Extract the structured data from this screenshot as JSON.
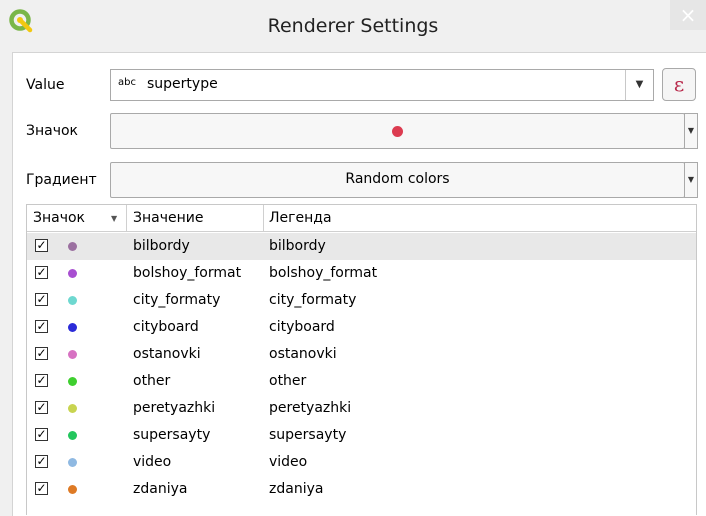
{
  "window": {
    "title": "Renderer Settings",
    "close_glyph": "×"
  },
  "form": {
    "value_label": "Value",
    "value_type_badge": "abc",
    "value_field": "supertype",
    "combo_arrow": "▼",
    "expression_glyph": "ε",
    "symbol_label": "Значок",
    "symbol_color": "#dc3b50",
    "ramp_label": "Градиент",
    "ramp_value": "Random colors"
  },
  "table": {
    "columns": [
      "Значок",
      "Значение",
      "Легенда"
    ],
    "sort_glyph": "▼",
    "check_glyph": "✓",
    "rows": [
      {
        "value": "bilbordy",
        "legend": "bilbordy",
        "color": "#9b70a0",
        "checked": true,
        "selected": true
      },
      {
        "value": "bolshoy_format",
        "legend": "bolshoy_format",
        "color": "#a84fd1",
        "checked": true
      },
      {
        "value": "city_formaty",
        "legend": "city_formaty",
        "color": "#6ed8d0",
        "checked": true
      },
      {
        "value": "cityboard",
        "legend": "cityboard",
        "color": "#2b2bd8",
        "checked": true
      },
      {
        "value": "ostanovki",
        "legend": "ostanovki",
        "color": "#d772c2",
        "checked": true
      },
      {
        "value": "other",
        "legend": "other",
        "color": "#3fcf2f",
        "checked": true
      },
      {
        "value": "peretyazhki",
        "legend": "peretyazhki",
        "color": "#c8d450",
        "checked": true
      },
      {
        "value": "supersayty",
        "legend": "supersayty",
        "color": "#23c65d",
        "checked": true
      },
      {
        "value": "video",
        "legend": "video",
        "color": "#8fb9e2",
        "checked": true
      },
      {
        "value": "zdaniya",
        "legend": "zdaniya",
        "color": "#de7a25",
        "checked": true
      }
    ]
  }
}
